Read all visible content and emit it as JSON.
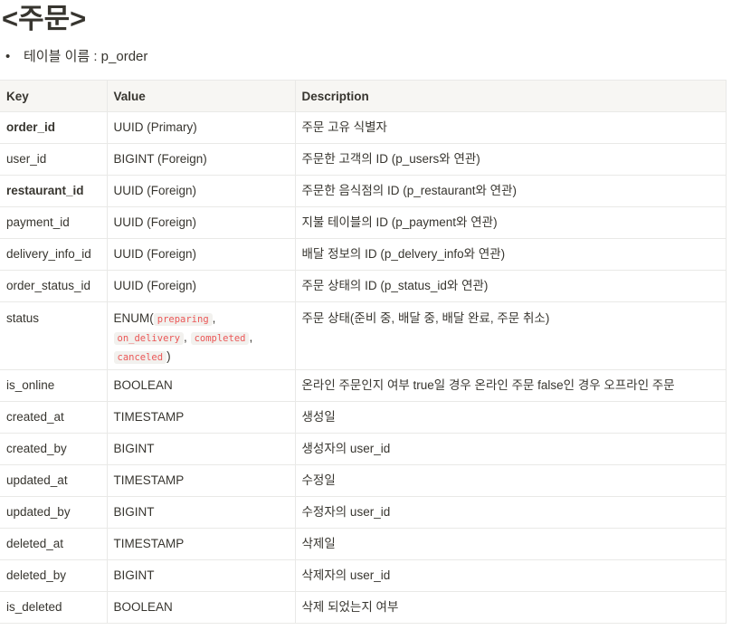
{
  "title": "<주문>",
  "bullet": {
    "text": "테이블 이름 : p_order"
  },
  "table": {
    "headers": [
      "Key",
      "Value",
      "Description"
    ],
    "rows": [
      {
        "key": "order_id",
        "value": "UUID (Primary)",
        "desc": "주문 고유 식별자",
        "bold": true
      },
      {
        "key": "user_id",
        "value": "BIGINT (Foreign)",
        "desc": "주문한 고객의 ID (p_users와 연관)",
        "bold": false
      },
      {
        "key": "restaurant_id",
        "value": "UUID (Foreign)",
        "desc": "주문한 음식점의 ID (p_restaurant와 연관)",
        "bold": true
      },
      {
        "key": "payment_id",
        "value": "UUID (Foreign)",
        "desc": "지불 테이블의 ID (p_payment와 연관)",
        "bold": false
      },
      {
        "key": "delivery_info_id",
        "value": "UUID (Foreign)",
        "desc": "배달 정보의 ID (p_delvery_info와 연관)",
        "bold": false
      },
      {
        "key": "order_status_id",
        "value": "UUID (Foreign)",
        "desc": "주문 상태의 ID (p_status_id와 연관)",
        "bold": false
      },
      {
        "key": "status",
        "value_prefix": "ENUM(",
        "value_suffix": ")",
        "enum": [
          "preparing",
          "on_delivery",
          "completed",
          "canceled"
        ],
        "desc": "주문 상태(준비 중, 배달 중, 배달 완료, 주문 취소)",
        "bold": false
      },
      {
        "key": "is_online",
        "value": "BOOLEAN",
        "desc": "온라인 주문인지 여부 true일 경우 온라인 주문 false인 경우 오프라인 주문",
        "bold": false
      },
      {
        "key": "created_at",
        "value": "TIMESTAMP",
        "desc": "생성일",
        "bold": false
      },
      {
        "key": "created_by",
        "value": "BIGINT",
        "desc": "생성자의 user_id",
        "bold": false
      },
      {
        "key": "updated_at",
        "value": "TIMESTAMP",
        "desc": "수정일",
        "bold": false
      },
      {
        "key": "updated_by",
        "value": "BIGINT",
        "desc": "수정자의 user_id",
        "bold": false
      },
      {
        "key": "deleted_at",
        "value": "TIMESTAMP",
        "desc": "삭제일",
        "bold": false
      },
      {
        "key": "deleted_by",
        "value": "BIGINT",
        "desc": "삭제자의 user_id",
        "bold": false
      },
      {
        "key": "is_deleted",
        "value": "BOOLEAN",
        "desc": "삭제 되었는지 여부",
        "bold": false
      }
    ]
  },
  "colors": {
    "text": "#37352f",
    "header_bg": "#f7f6f3",
    "border": "#e9e9e7",
    "code_text": "#eb5757",
    "code_bg": "#f2f1ee"
  }
}
